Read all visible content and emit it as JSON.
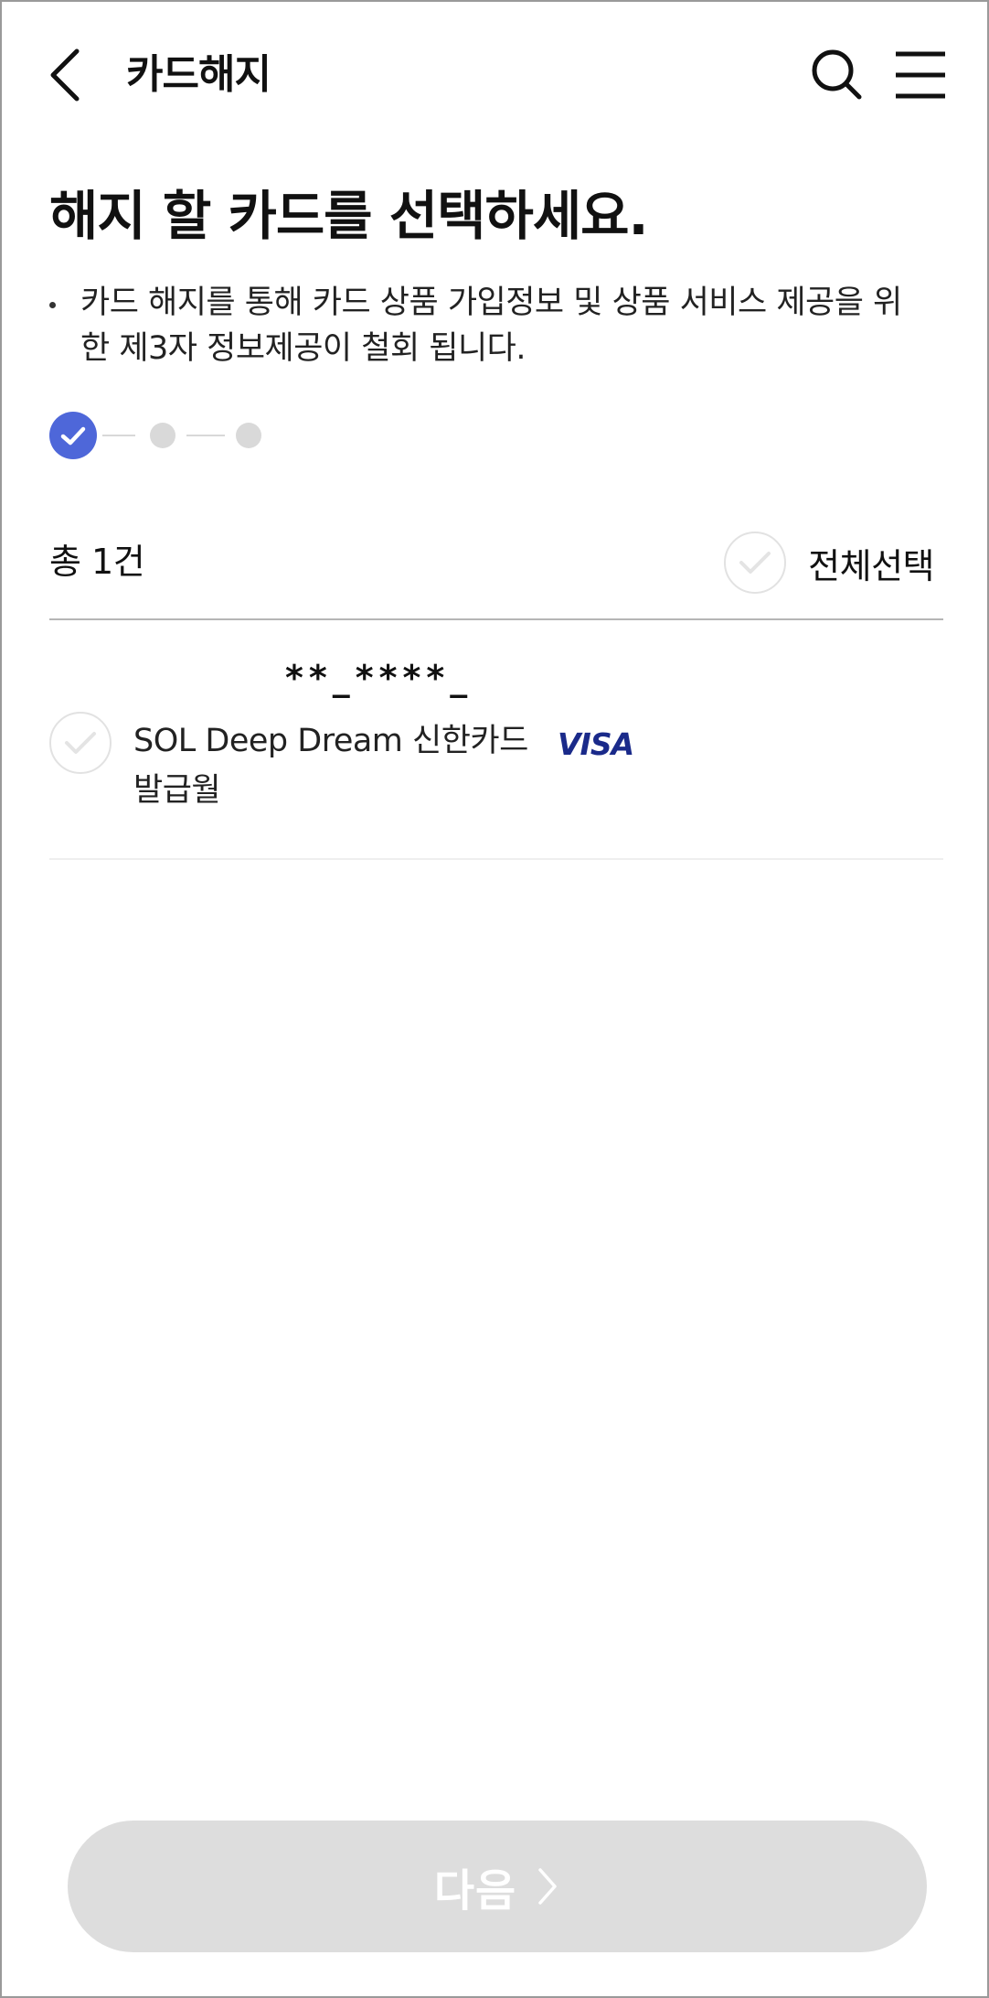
{
  "header": {
    "title": "카드해지"
  },
  "main": {
    "headline": "해지 할 카드를 선택하세요.",
    "notice": "카드 해지를 통해 카드 상품 가입정보 및 상품 서비스 제공을 위한 제3자 정보제공이 철회 됩니다.",
    "stepper": {
      "total_steps": 3,
      "current_step": 1
    },
    "total_count": "총 1건",
    "select_all_label": "전체선택",
    "select_all_checked": false
  },
  "cards": [
    {
      "masked_number": "**_****_",
      "name": "SOL Deep Dream 신한카드",
      "brand": "VISA",
      "issue_label": "발급월",
      "checked": false
    }
  ],
  "footer": {
    "next_label": "다음"
  },
  "colors": {
    "accent": "#4e67d9",
    "disabled_button": "#dddddd",
    "visa_brand": "#1a2a8a"
  }
}
